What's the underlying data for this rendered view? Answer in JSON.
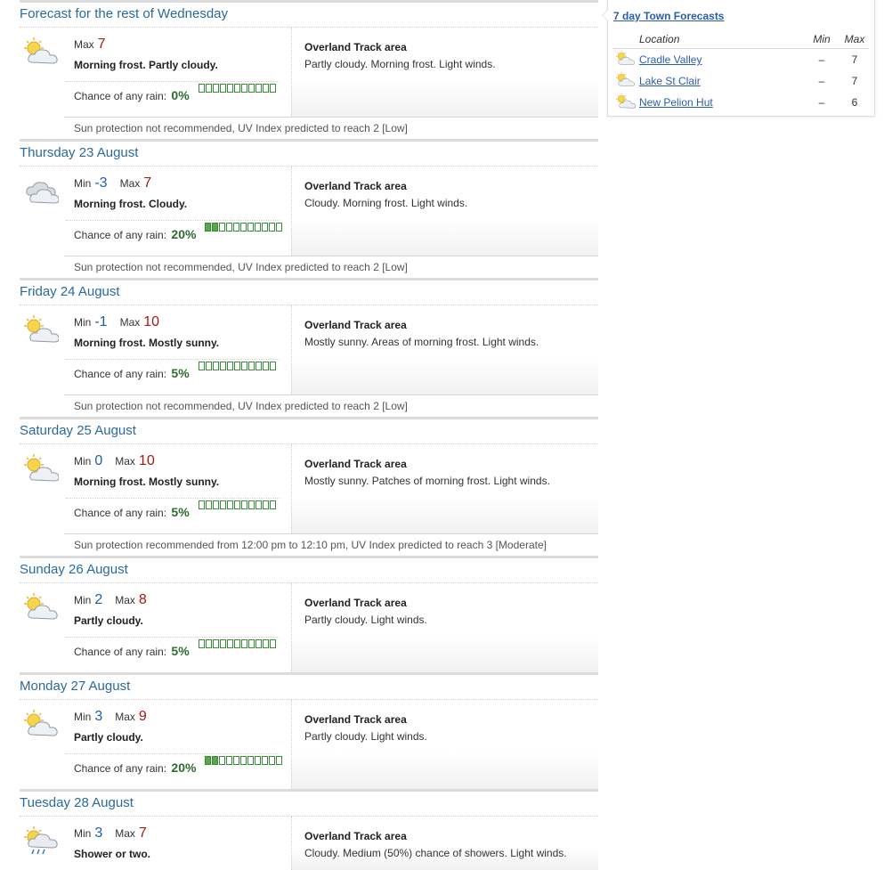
{
  "days": [
    {
      "title": "Forecast for the rest of Wednesday",
      "icon": "partly-cloudy-icon",
      "min_label": "",
      "min": "",
      "max_label": "Max",
      "max": "7",
      "summary": "Morning frost. Partly cloudy.",
      "rain_label": "Chance of any rain:",
      "rain_pct": "0%",
      "rain_fraction": 0,
      "district_name": "Overland Track area",
      "district_text": "Partly cloudy. Morning frost. Light winds.",
      "uv": "Sun protection not recommended, UV Index predicted to reach 2 [Low]"
    },
    {
      "title": "Thursday 23 August",
      "icon": "cloudy-icon",
      "min_label": "Min",
      "min": "-3",
      "max_label": "Max",
      "max": "7",
      "summary": "Morning frost. Cloudy.",
      "rain_label": "Chance of any rain:",
      "rain_pct": "20%",
      "rain_fraction": 0.2,
      "district_name": "Overland Track area",
      "district_text": "Cloudy. Morning frost. Light winds.",
      "uv": "Sun protection not recommended, UV Index predicted to reach 2 [Low]"
    },
    {
      "title": "Friday 24 August",
      "icon": "mostly-sunny-icon",
      "min_label": "Min",
      "min": "-1",
      "max_label": "Max",
      "max": "10",
      "summary": "Morning frost. Mostly sunny.",
      "rain_label": "Chance of any rain:",
      "rain_pct": "5%",
      "rain_fraction": 0,
      "district_name": "Overland Track area",
      "district_text": "Mostly sunny. Areas of morning frost. Light winds.",
      "uv": "Sun protection not recommended, UV Index predicted to reach 2 [Low]"
    },
    {
      "title": "Saturday 25 August",
      "icon": "mostly-sunny-icon",
      "min_label": "Min",
      "min": "0",
      "max_label": "Max",
      "max": "10",
      "summary": "Morning frost. Mostly sunny.",
      "rain_label": "Chance of any rain:",
      "rain_pct": "5%",
      "rain_fraction": 0,
      "district_name": "Overland Track area",
      "district_text": "Mostly sunny. Patches of morning frost. Light winds.",
      "uv": "Sun protection recommended from 12:00 pm to 12:10 pm, UV Index predicted to reach 3 [Moderate]"
    },
    {
      "title": "Sunday 26 August",
      "icon": "partly-cloudy-icon",
      "min_label": "Min",
      "min": "2",
      "max_label": "Max",
      "max": "8",
      "summary": "Partly cloudy.",
      "rain_label": "Chance of any rain:",
      "rain_pct": "5%",
      "rain_fraction": 0,
      "district_name": "Overland Track area",
      "district_text": "Partly cloudy. Light winds.",
      "uv": ""
    },
    {
      "title": "Monday 27 August",
      "icon": "partly-cloudy-icon",
      "min_label": "Min",
      "min": "3",
      "max_label": "Max",
      "max": "9",
      "summary": "Partly cloudy.",
      "rain_label": "Chance of any rain:",
      "rain_pct": "20%",
      "rain_fraction": 0.2,
      "district_name": "Overland Track area",
      "district_text": "Partly cloudy. Light winds.",
      "uv": ""
    },
    {
      "title": "Tuesday 28 August",
      "icon": "showers-icon",
      "min_label": "Min",
      "min": "3",
      "max_label": "Max",
      "max": "7",
      "summary": "Shower or two.",
      "rain_label": "",
      "rain_pct": "",
      "rain_fraction": 0,
      "district_name": "Overland Track area",
      "district_text": "Cloudy. Medium (50%) chance of showers. Light winds.",
      "uv": ""
    }
  ],
  "side": {
    "title": "7 day Town Forecasts",
    "col_location": "Location",
    "col_min": "Min",
    "col_max": "Max",
    "rows": [
      {
        "icon": "partly-cloudy-icon",
        "location": "Cradle Valley",
        "min": "–",
        "max": "7"
      },
      {
        "icon": "partly-cloudy-icon",
        "location": "Lake St Clair",
        "min": "–",
        "max": "7"
      },
      {
        "icon": "mostly-sunny-icon",
        "location": "New Pelion Hut",
        "min": "–",
        "max": "6"
      }
    ]
  },
  "colors": {
    "heading": "#2a6a9a",
    "min_temp": "#1f5fa6",
    "max_temp": "#a31a1a",
    "rain_pct": "#2e6b2e",
    "rain_bar": "#5aa64a",
    "link": "#2a5db0"
  }
}
